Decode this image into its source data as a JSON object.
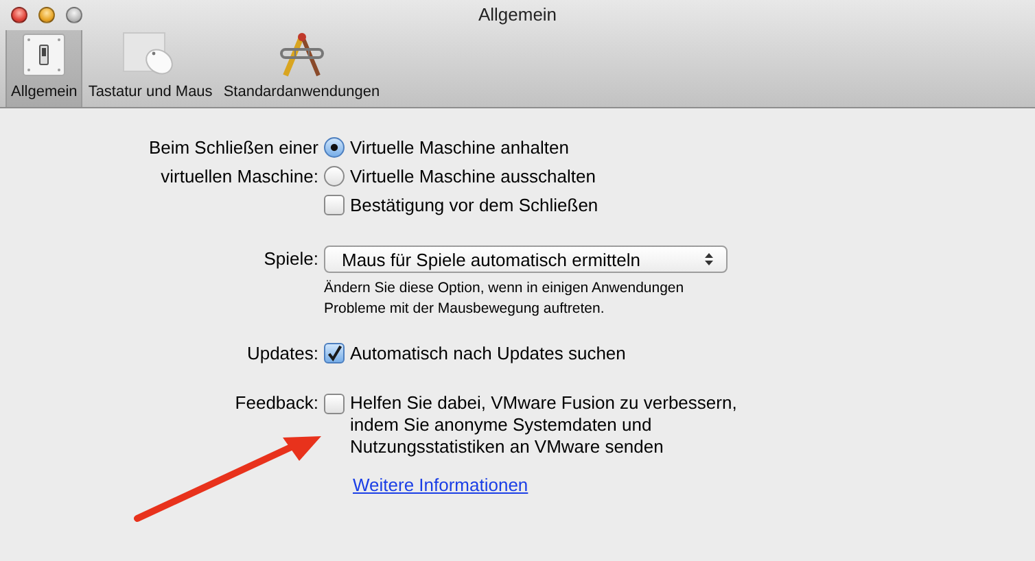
{
  "window": {
    "title": "Allgemein"
  },
  "toolbar": [
    {
      "label": "Allgemein",
      "kind": "switch",
      "selected": true
    },
    {
      "label": "Tastatur und Maus",
      "kind": "mouse",
      "selected": false
    },
    {
      "label": "Standardanwendungen",
      "kind": "tools",
      "selected": false
    }
  ],
  "sections": [
    {
      "label": "Beim Schließen einer\nvirtuellen Maschine:",
      "controls": [
        {
          "kind": "radio",
          "label": "Virtuelle Maschine anhalten",
          "selected": true
        },
        {
          "kind": "radio",
          "label": "Virtuelle Maschine ausschalten",
          "selected": false
        },
        {
          "kind": "checkbox",
          "label": "Bestätigung vor dem Schließen",
          "checked": false
        }
      ]
    },
    {
      "label": "Spiele:",
      "controls": [
        {
          "kind": "popup",
          "value": "Maus für Spiele automatisch ermitteln"
        },
        {
          "kind": "note",
          "text": "Ändern Sie diese Option, wenn in einigen Anwendungen\nProbleme mit der Mausbewegung auftreten."
        }
      ]
    },
    {
      "label": "Updates:",
      "controls": [
        {
          "kind": "checkbox",
          "label": "Automatisch nach Updates suchen",
          "checked": true
        }
      ]
    },
    {
      "label": "Feedback:",
      "controls": [
        {
          "kind": "checkbox",
          "label": "Helfen Sie dabei, VMware Fusion zu verbessern,\nindem Sie anonyme Systemdaten und\nNutzungsstatistiken an VMware senden",
          "checked": false
        },
        {
          "kind": "link",
          "text": "Weitere Informationen"
        }
      ]
    }
  ]
}
